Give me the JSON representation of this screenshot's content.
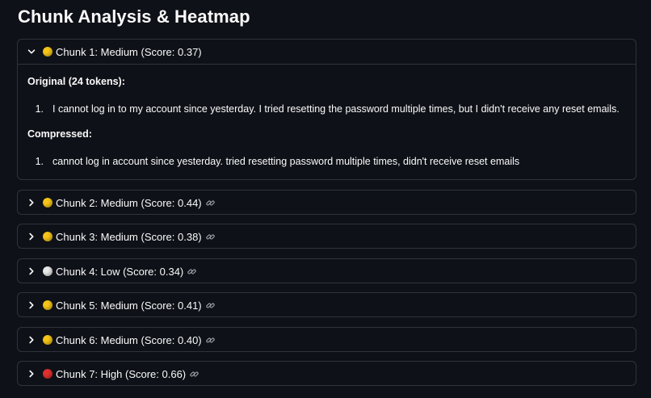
{
  "page_title": "Chunk Analysis & Heatmap",
  "chunks": [
    {
      "label": "Chunk 1: Medium (Score: 0.37)",
      "color": "#f5c518",
      "expanded": true,
      "original_heading": "Original (24 tokens):",
      "original_num": "1.",
      "original_text": "I cannot log in to my account since yesterday. I tried resetting the password multiple times, but I didn't receive any reset emails.",
      "compressed_heading": "Compressed:",
      "compressed_num": "1.",
      "compressed_text": "cannot log in account since yesterday. tried resetting password multiple times, didn't receive reset emails"
    },
    {
      "label": "Chunk 2: Medium (Score: 0.44)",
      "color": "#f5c518",
      "expanded": false
    },
    {
      "label": "Chunk 3: Medium (Score: 0.38)",
      "color": "#f5c518",
      "expanded": false
    },
    {
      "label": "Chunk 4: Low (Score: 0.34)",
      "color": "#e8e8e8",
      "expanded": false
    },
    {
      "label": "Chunk 5: Medium (Score: 0.41)",
      "color": "#f5c518",
      "expanded": false
    },
    {
      "label": "Chunk 6: Medium (Score: 0.40)",
      "color": "#f5c518",
      "expanded": false
    },
    {
      "label": "Chunk 7: High (Score: 0.66)",
      "color": "#e0302f",
      "expanded": false
    }
  ]
}
